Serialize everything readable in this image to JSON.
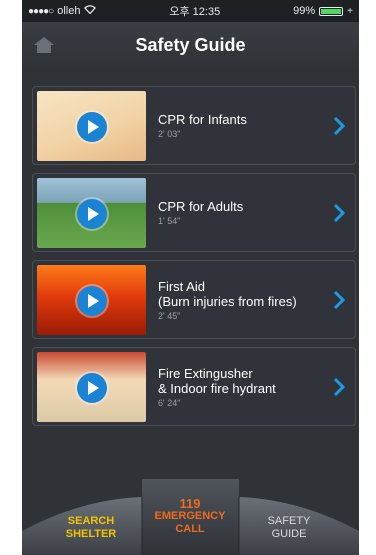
{
  "status": {
    "carrier": "olleh",
    "time": "오후 12:35",
    "battery": "99%",
    "battery_level": 0.99
  },
  "navbar": {
    "title": "Safety Guide",
    "home_icon": "home-icon"
  },
  "videos": [
    {
      "title": "CPR for Infants",
      "subtitle": "",
      "duration": "2' 03\""
    },
    {
      "title": "CPR for Adults",
      "subtitle": "",
      "duration": "1' 54\""
    },
    {
      "title": "First Aid",
      "subtitle": "(Burn injuries from fires)",
      "duration": "2' 45\""
    },
    {
      "title": "Fire Extingusher",
      "subtitle": "& Indoor fire hydrant",
      "duration": "6' 24\""
    }
  ],
  "tabbar": {
    "search_line1": "SEARCH",
    "search_line2": "SHELTER",
    "emergency_num": "119",
    "emergency_line1": "EMERGENCY",
    "emergency_line2": "CALL",
    "safety_line1": "SAFETY",
    "safety_line2": "GUIDE"
  },
  "colors": {
    "accent_blue": "#1b83d3",
    "search_yellow": "#f2c300",
    "emergency_orange": "#f06a1d",
    "background": "#2f3338"
  }
}
